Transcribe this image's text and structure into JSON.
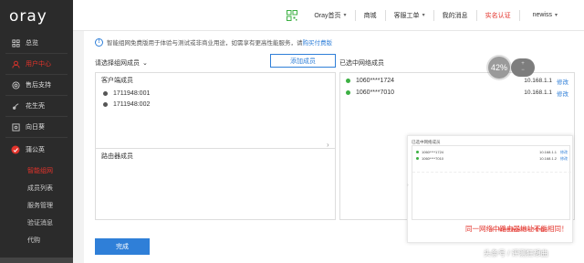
{
  "brand": "oray",
  "sidebar": {
    "items": [
      {
        "label": "总览",
        "icon": "grid-icon"
      },
      {
        "label": "用户中心",
        "icon": "user-icon",
        "active": true
      },
      {
        "label": "售后支持",
        "icon": "support-icon"
      },
      {
        "label": "花生壳",
        "icon": "peanut-icon"
      },
      {
        "label": "向日葵",
        "icon": "sunflower-icon"
      },
      {
        "label": "蒲公英",
        "icon": "dandelion-icon"
      }
    ],
    "sub_items": [
      {
        "label": "智能组网",
        "active": true
      },
      {
        "label": "成员列表"
      },
      {
        "label": "服务管理"
      },
      {
        "label": "验证消息"
      },
      {
        "label": "代购"
      }
    ]
  },
  "header": {
    "home": "Oray首页",
    "mall": "商城",
    "service": "客服工单",
    "messages": "我的消息",
    "verify": "实名认证",
    "user": "newiss",
    "accent": "#e3332b"
  },
  "notice": {
    "text": "智能组网免费版用于体验与测试或非商业用途，如需享有更高性能服务，请",
    "link": "购买付费版"
  },
  "left": {
    "title": "请选择组网成员",
    "add_button": "添加成员",
    "group_label": "客户端成员",
    "members": [
      "1711948:001",
      "1711948:002"
    ],
    "router_label": "路由器成员"
  },
  "right": {
    "title": "已选中网络成员",
    "selected": [
      {
        "name": "1060****1724",
        "ip": "10.168.1.1",
        "edit": "修改"
      },
      {
        "name": "1060****7010",
        "ip": "10.168.1.1",
        "edit": "修改"
      }
    ],
    "zoom": "42%"
  },
  "inset": {
    "title": "已选中网络成员",
    "rows": [
      {
        "name": "1060****1724",
        "ip": "10.168.1.1",
        "edit": "修改"
      },
      {
        "name": "1060****7010",
        "ip": "10.168.1.2",
        "edit": "修改"
      }
    ],
    "caption": "同一网络中路由器地址不能相同"
  },
  "warning": "同一网络中路由器地址不能相同！",
  "done_button": "完成",
  "watermark": "头条号 / 评测狂想曲"
}
